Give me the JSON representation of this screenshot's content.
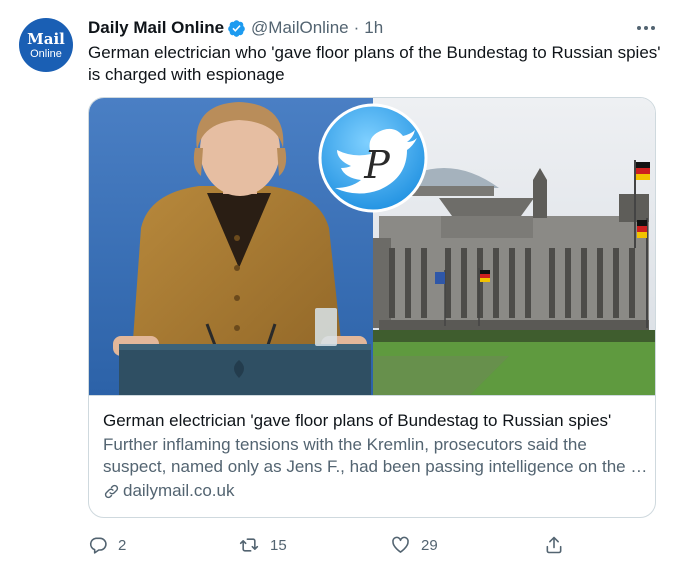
{
  "tweet": {
    "avatar": {
      "line1": "Mail",
      "line2": "Online"
    },
    "author_name": "Daily Mail Online",
    "handle": "@MailOnline",
    "separator": "·",
    "time": "1h",
    "text": "German electrician who 'gave floor plans of the Bundestag to Russian spies' is charged with espionage",
    "card": {
      "title": "German electrician 'gave floor plans of Bundestag to Russian spies'",
      "description": "Further inflaming tensions with the Kremlin, prosecutors said the suspect, named only as Jens F., had been passing intelligence on the …",
      "domain": "dailymail.co.uk",
      "watermark_letter": "P"
    },
    "actions": {
      "replies": "2",
      "retweets": "15",
      "likes": "29"
    }
  },
  "colors": {
    "accent": "#1d9bf0",
    "text_primary": "#0f1419",
    "text_secondary": "#536471",
    "border": "#cfd9de",
    "avatar_bg": "#1a5fb4"
  },
  "icons": [
    "verified-badge-icon",
    "more-icon",
    "link-icon",
    "reply-icon",
    "retweet-icon",
    "like-icon",
    "share-icon",
    "twitter-bird-icon"
  ]
}
